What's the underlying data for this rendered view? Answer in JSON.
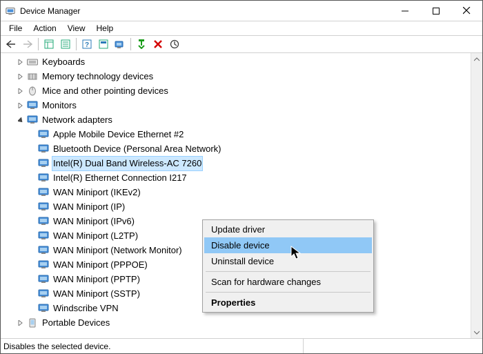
{
  "window": {
    "title": "Device Manager"
  },
  "menu": {
    "file": "File",
    "action": "Action",
    "view": "View",
    "help": "Help"
  },
  "status": {
    "text": "Disables the selected device."
  },
  "context_menu": {
    "update": "Update driver",
    "disable": "Disable device",
    "uninstall": "Uninstall device",
    "scan": "Scan for hardware changes",
    "properties": "Properties"
  },
  "tree": {
    "keyboards": "Keyboards",
    "memory_tech": "Memory technology devices",
    "mice": "Mice and other pointing devices",
    "monitors": "Monitors",
    "network_adapters": "Network adapters",
    "portable_devices": "Portable Devices",
    "net": {
      "apple": "Apple Mobile Device Ethernet #2",
      "bt": "Bluetooth Device (Personal Area Network)",
      "intel_wifi": "Intel(R) Dual Band Wireless-AC 7260",
      "intel_eth": "Intel(R) Ethernet Connection I217",
      "ikev2": "WAN Miniport (IKEv2)",
      "ip": "WAN Miniport (IP)",
      "ipv6": "WAN Miniport (IPv6)",
      "l2tp": "WAN Miniport (L2TP)",
      "netmon": "WAN Miniport (Network Monitor)",
      "pppoe": "WAN Miniport (PPPOE)",
      "pptp": "WAN Miniport (PPTP)",
      "sstp": "WAN Miniport (SSTP)",
      "windscribe": "Windscribe VPN"
    }
  }
}
